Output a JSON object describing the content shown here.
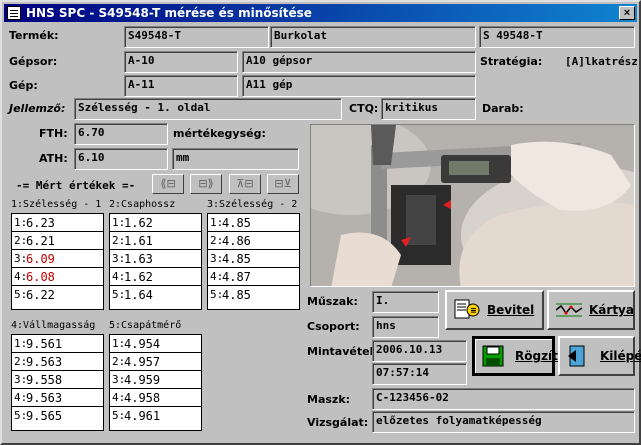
{
  "window": {
    "title": "HNS SPC - S49548-T mérése és minősítése",
    "close": "×"
  },
  "labels": {
    "termek": "Termék:",
    "gepsor": "Gépsor:",
    "gep": "Gép:",
    "strategia": "Stratégia:",
    "jellemzo": "Jellemző:",
    "ctq": "CTQ:",
    "darab": "Darab:",
    "fth": "FTH:",
    "ath": "ATH:",
    "mertekegyseg": "mértékegység:",
    "mert_ertekek": "-= Mért értékek =-",
    "muszak": "Műszak:",
    "csoport": "Csoport:",
    "mintavetel": "Mintavétel:",
    "maszk": "Maszk:",
    "vizsgalat": "Vizsgálat:"
  },
  "fields": {
    "termek_code": "S49548-T",
    "termek_name": "Burkolat",
    "termek_id": "S 49548-T",
    "gepsor_code": "A-10",
    "gepsor_name": "A10 gépsor",
    "strategia_value": "[A]lkatrész",
    "gep_code": "A-11",
    "gep_name": "A11 gép",
    "jellemzo_value": "Szélesség - 1. oldal",
    "ctq_value": "kritikus",
    "fth_value": "6.70",
    "ath_value": "6.10",
    "unit_value": "mm",
    "muszak_value": "I.",
    "csoport_value": "hns",
    "date_value": "2006.10.13",
    "time_value": "07:57:14",
    "maszk_value": "C-123456-02",
    "vizsgalat_value": "előzetes folyamatképesség"
  },
  "toolbar": [
    "⟪⊟",
    "⊟⟫",
    "⊼⊟",
    "⊟⊻"
  ],
  "measurements": [
    {
      "title": "1:Szélesség - 1",
      "rows": [
        {
          "i": "1:",
          "v": "6.23",
          "red": false
        },
        {
          "i": "2:",
          "v": "6.21",
          "red": false
        },
        {
          "i": "3:",
          "v": "6.09",
          "red": true
        },
        {
          "i": "4:",
          "v": "6.08",
          "red": true
        },
        {
          "i": "5:",
          "v": "6.22",
          "red": false
        }
      ]
    },
    {
      "title": "2:Csaphossz",
      "rows": [
        {
          "i": "1:",
          "v": "1.62",
          "red": false
        },
        {
          "i": "2:",
          "v": "1.61",
          "red": false
        },
        {
          "i": "3:",
          "v": "1.63",
          "red": false
        },
        {
          "i": "4:",
          "v": "1.62",
          "red": false
        },
        {
          "i": "5:",
          "v": "1.64",
          "red": false
        }
      ]
    },
    {
      "title": "3:Szélesség - 2",
      "rows": [
        {
          "i": "1:",
          "v": "4.85",
          "red": false
        },
        {
          "i": "2:",
          "v": "4.86",
          "red": false
        },
        {
          "i": "3:",
          "v": "4.85",
          "red": false
        },
        {
          "i": "4:",
          "v": "4.87",
          "red": false
        },
        {
          "i": "5:",
          "v": "4.85",
          "red": false
        }
      ]
    },
    {
      "title": "4:Vállmagasság",
      "rows": [
        {
          "i": "1:",
          "v": "9.561",
          "red": false
        },
        {
          "i": "2:",
          "v": "9.563",
          "red": false
        },
        {
          "i": "3:",
          "v": "9.558",
          "red": false
        },
        {
          "i": "4:",
          "v": "9.563",
          "red": false
        },
        {
          "i": "5:",
          "v": "9.565",
          "red": false
        }
      ]
    },
    {
      "title": "5:Csapátmérő",
      "rows": [
        {
          "i": "1:",
          "v": "4.954",
          "red": false
        },
        {
          "i": "2:",
          "v": "4.957",
          "red": false
        },
        {
          "i": "3:",
          "v": "4.959",
          "red": false
        },
        {
          "i": "4:",
          "v": "4.958",
          "red": false
        },
        {
          "i": "5:",
          "v": "4.961",
          "red": false
        }
      ]
    }
  ],
  "buttons": {
    "bevitel": "Bevitel",
    "kartya": "Kártya",
    "rogzites": "Rögzítés",
    "kilepes": "Kilépés"
  },
  "icons": {
    "bevitel": "data-entry-icon",
    "kartya": "control-chart-icon",
    "rogzites": "save-disk-icon",
    "kilepes": "exit-door-icon"
  }
}
